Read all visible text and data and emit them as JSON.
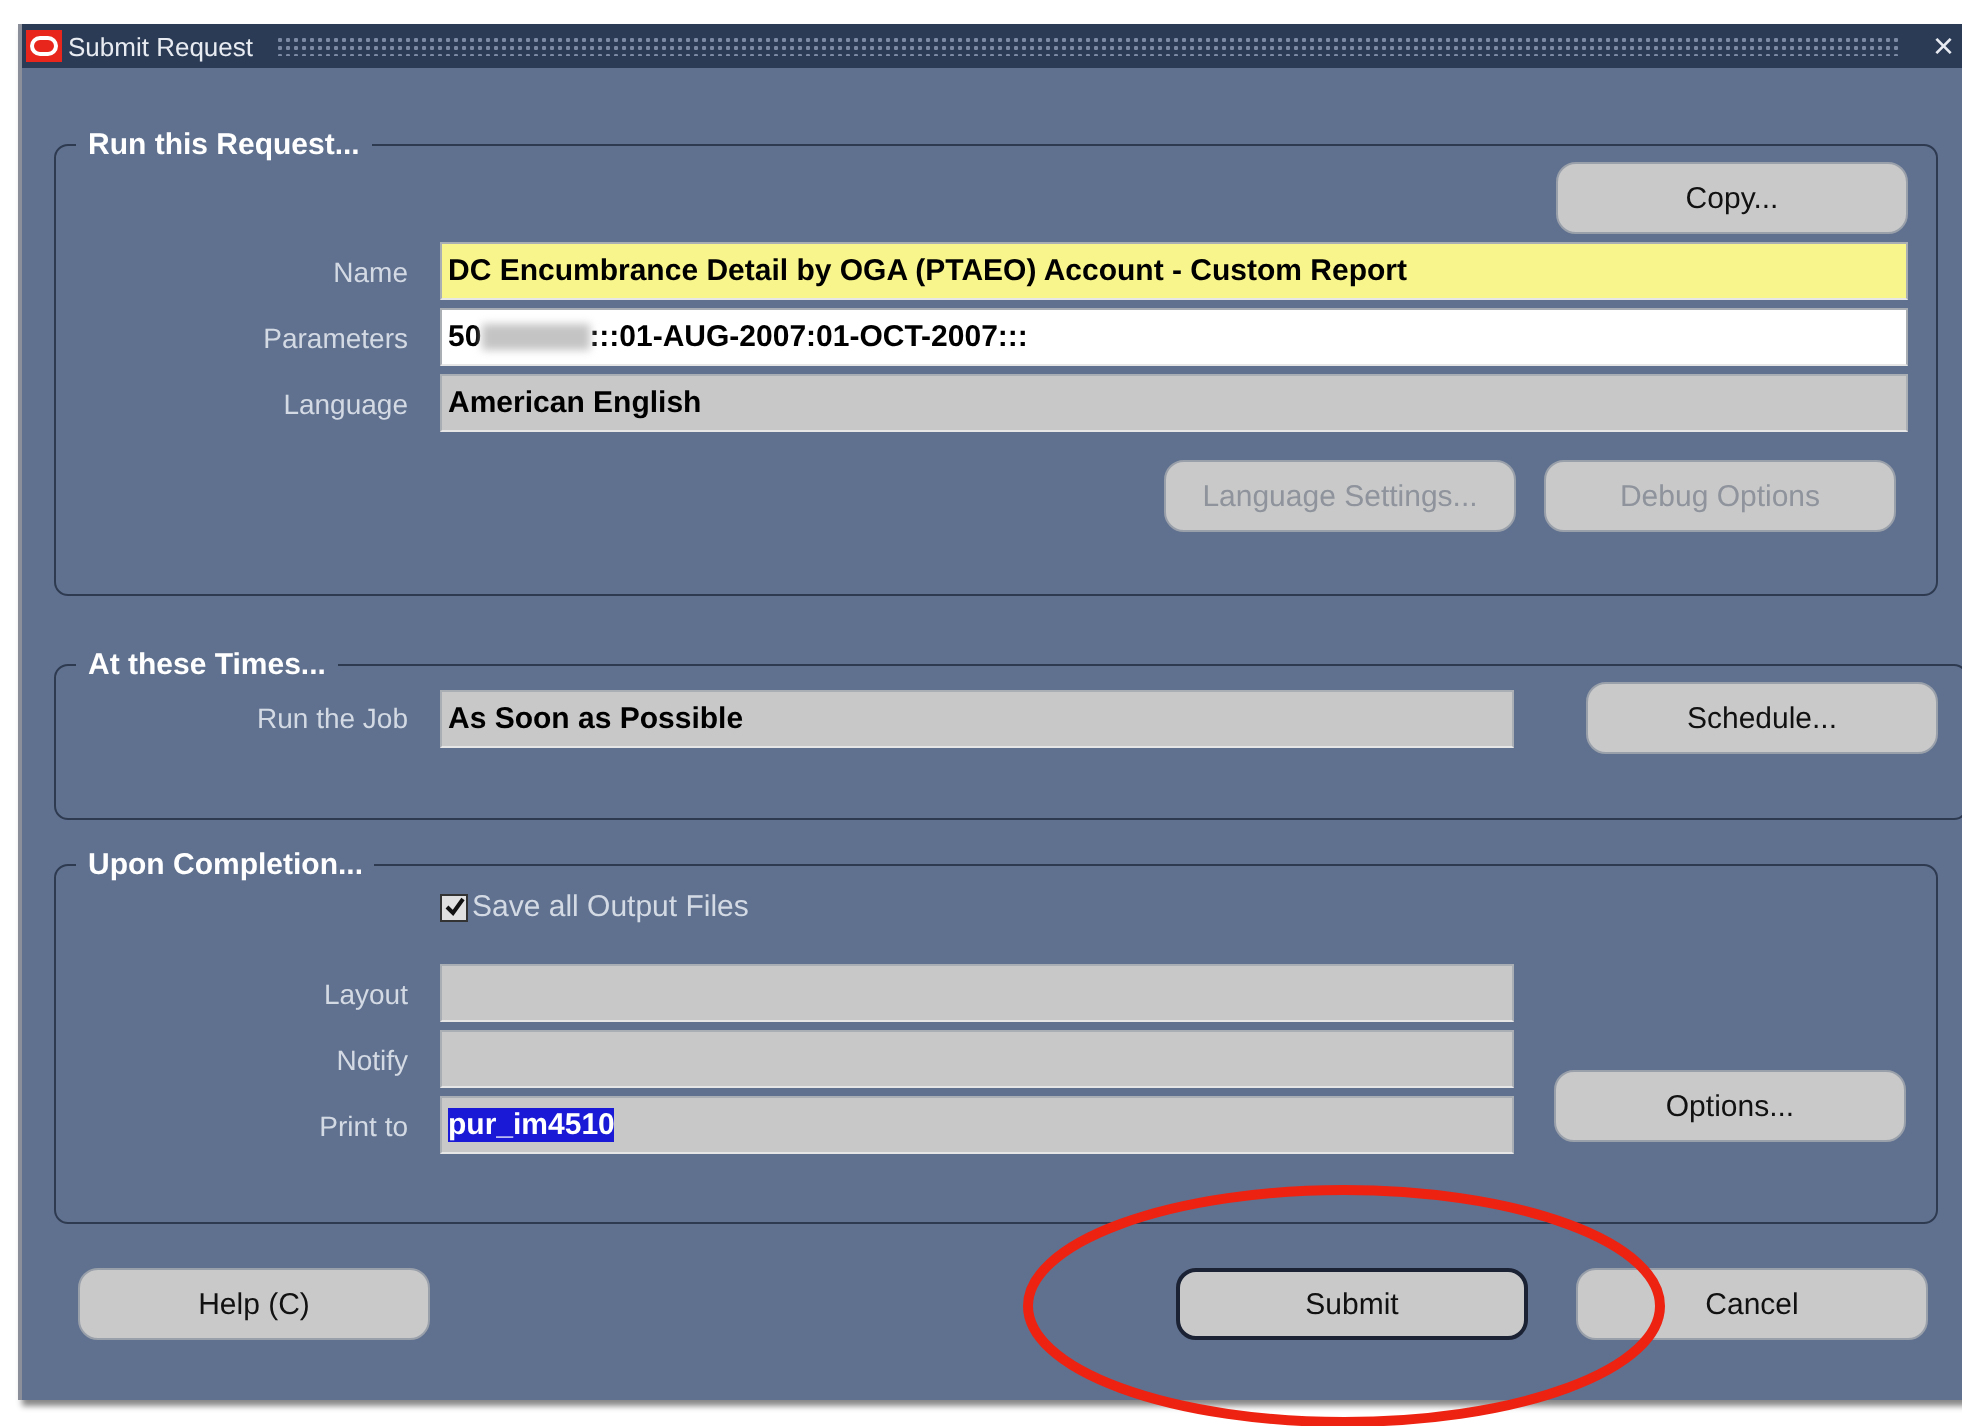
{
  "window": {
    "title": "Submit Request",
    "close": "×"
  },
  "run_request": {
    "legend": "Run this Request...",
    "copy_button": {
      "label": "Copy..."
    },
    "name": {
      "label": "Name",
      "value": "DC Encumbrance Detail by OGA (PTAEO) Account - Custom Report",
      "required": true
    },
    "parameters": {
      "label": "Parameters",
      "value_start": "50",
      "redacted": true,
      "value_end": ":::01-AUG-2007:01-OCT-2007:::"
    },
    "language": {
      "label": "Language",
      "value": "American English"
    },
    "buttons": [
      {
        "label": "Language Settings...",
        "disabled": true
      },
      {
        "label": "Debug Options",
        "disabled": true
      }
    ]
  },
  "at_these_times": {
    "legend": "At these Times...",
    "run_job": {
      "label": "Run the Job",
      "value": "As Soon as Possible"
    },
    "schedule_button": {
      "label": "Schedule..."
    }
  },
  "upon_completion": {
    "legend": "Upon Completion...",
    "save_output": {
      "label": "Save all Output Files",
      "checked": true
    },
    "fields": [
      {
        "label": "Layout"
      },
      {
        "label": "Notify"
      },
      {
        "label": "Print to",
        "value": "pur_im4510",
        "highlighted": true
      }
    ],
    "options_button": {
      "label": "Options..."
    }
  },
  "footer_buttons": [
    {
      "label": "Help (C)",
      "default": false
    },
    {
      "label": "Submit",
      "default": true
    },
    {
      "label": "Cancel",
      "default": false
    }
  ],
  "annotation": {
    "kind": "ellipse",
    "color": "#ee2211"
  }
}
